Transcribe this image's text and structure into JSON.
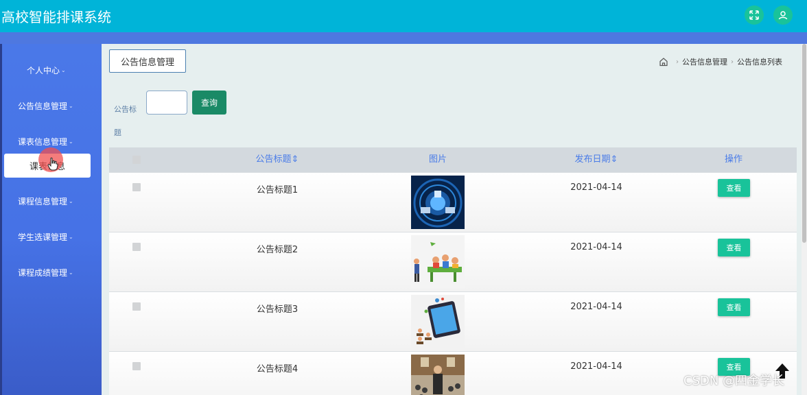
{
  "app": {
    "title": "高校智能排课系统"
  },
  "sidebar": {
    "items": [
      {
        "label": "个人中心"
      },
      {
        "label": "公告信息管理"
      },
      {
        "label": "课表信息管理"
      },
      {
        "label": "课程信息管理"
      },
      {
        "label": "学生选课管理"
      },
      {
        "label": "课程成绩管理"
      }
    ],
    "active_sub": "课表信息"
  },
  "page": {
    "tag": "公告信息管理",
    "breadcrumb": [
      "公告信息管理",
      "公告信息列表"
    ]
  },
  "search": {
    "label": "公告标题",
    "value": "",
    "button": "查询"
  },
  "table": {
    "columns": [
      "公告标题",
      "图片",
      "发布日期",
      "操作"
    ],
    "sort_indicator": "⇕",
    "rows": [
      {
        "title": "公告标题1",
        "date": "2021-04-14",
        "action": "查看"
      },
      {
        "title": "公告标题2",
        "date": "2021-04-14",
        "action": "查看"
      },
      {
        "title": "公告标题3",
        "date": "2021-04-14",
        "action": "查看"
      },
      {
        "title": "公告标题4",
        "date": "2021-04-14",
        "action": "查看"
      }
    ]
  },
  "watermark": "CSDN @四金学长",
  "colors": {
    "header": "#00b4d8",
    "sidebar": "#4a78e8",
    "accent": "#19c39a",
    "search_button": "#1a8a66",
    "column_header_text": "#4a7ce8"
  }
}
